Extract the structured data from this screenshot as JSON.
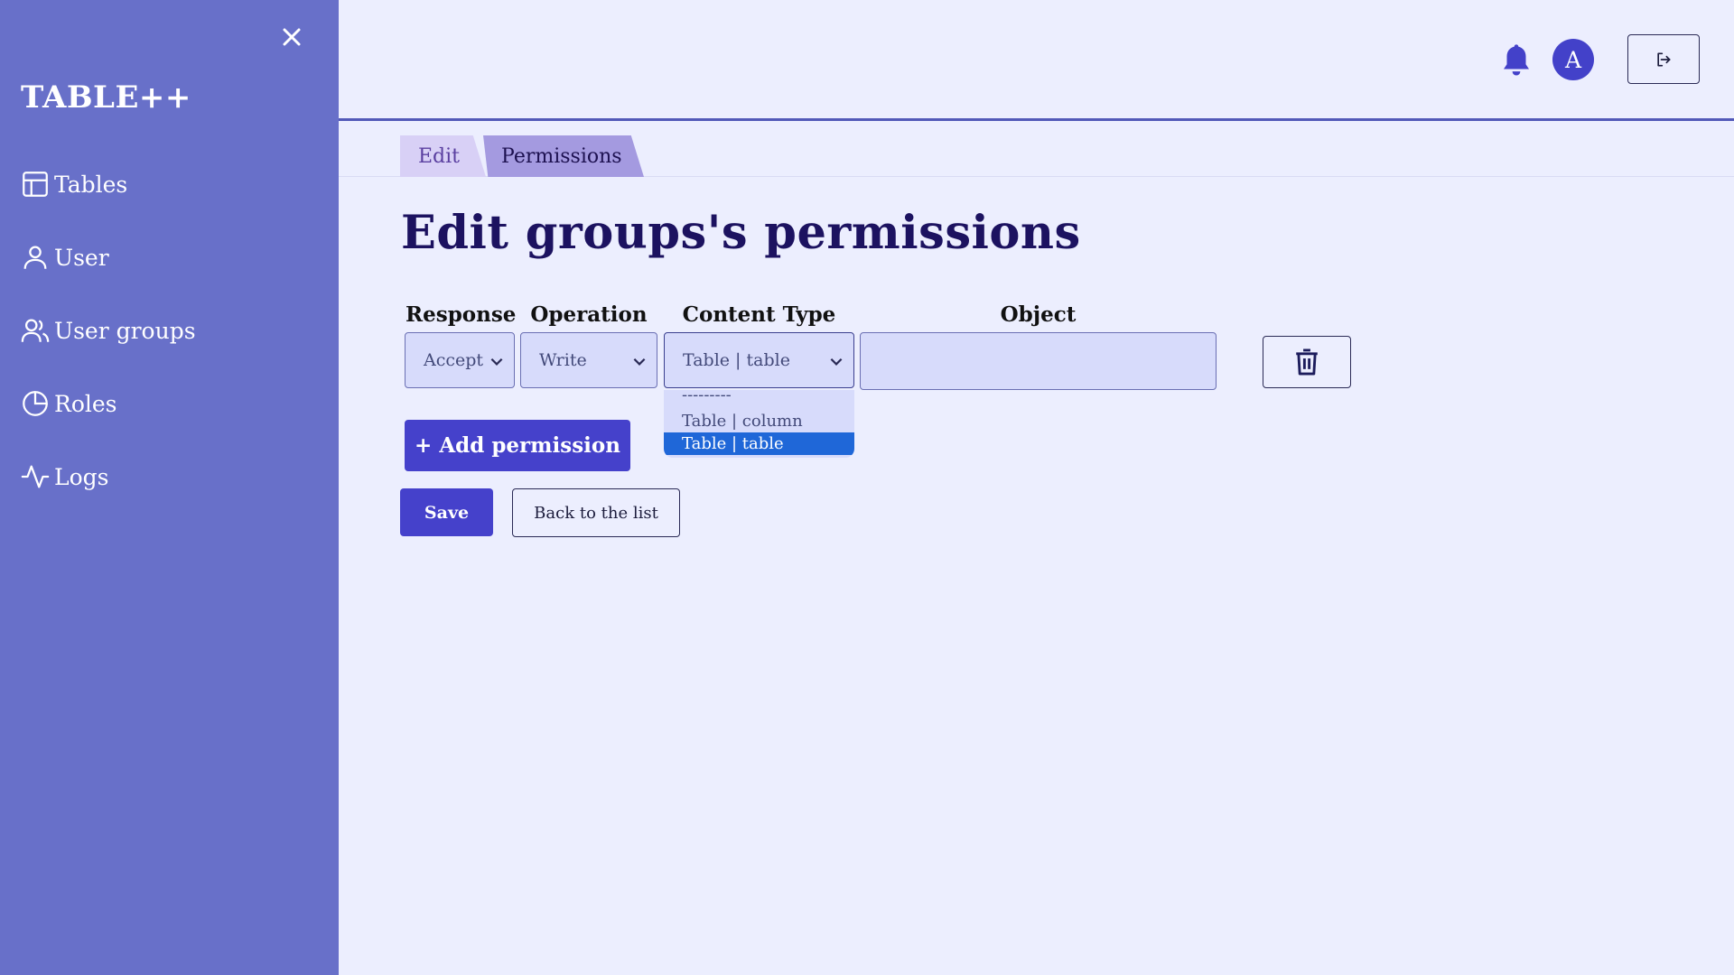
{
  "sidebar": {
    "brand": "TABLE++",
    "close_icon": "close-icon",
    "items": [
      {
        "label": "Tables",
        "icon": "table-icon"
      },
      {
        "label": "User",
        "icon": "user-icon"
      },
      {
        "label": "User groups",
        "icon": "users-icon"
      },
      {
        "label": "Roles",
        "icon": "pie-chart-icon"
      },
      {
        "label": "Logs",
        "icon": "activity-icon"
      }
    ]
  },
  "header": {
    "avatar_letter": "A",
    "bell_icon": "bell-icon",
    "logout_icon": "logout-icon"
  },
  "tabs": [
    {
      "label": "Edit"
    },
    {
      "label": "Permissions"
    }
  ],
  "page": {
    "title": "Edit groups's permissions"
  },
  "form": {
    "columns": {
      "response": "Response",
      "operation": "Operation",
      "content_type": "Content Type",
      "object": "Object"
    },
    "row": {
      "response_value": "Accept",
      "operation_value": "Write",
      "content_type_value": "Table | table",
      "object_value": ""
    },
    "content_type_options": [
      "---------",
      "Table | column",
      "Table | table"
    ],
    "add_permission_label": "+ Add permission",
    "save_label": "Save",
    "back_label": "Back to the list"
  },
  "colors": {
    "sidebar_bg": "#6870c9",
    "page_bg": "#eceefe",
    "primary": "#4541cb",
    "selected_option": "#1f67d8"
  }
}
